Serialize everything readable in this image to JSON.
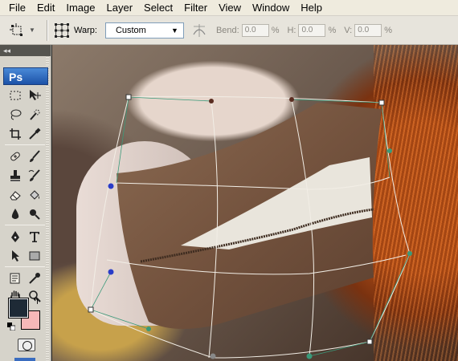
{
  "menu": [
    "File",
    "Edit",
    "Image",
    "Layer",
    "Select",
    "Filter",
    "View",
    "Window",
    "Help"
  ],
  "options": {
    "tool_preset_icon": "transform-tool-icon",
    "warp_icon": "warp-grid-icon",
    "warp_label": "Warp:",
    "warp_value": "Custom",
    "orientation_icon": "change-warp-orientation-icon",
    "bend_label": "Bend:",
    "bend_value": "0.0",
    "h_label": "H:",
    "h_value": "0.0",
    "v_label": "V:",
    "v_value": "0.0",
    "percent": "%"
  },
  "toolbox": {
    "collapse": "◂◂",
    "logo": "Ps",
    "foreground_color": "#1e2a36",
    "background_color": "#f6b8b8"
  },
  "canvas": {
    "warp_grid_color": "#f2eee6",
    "handle_color": "#3a9a7a"
  }
}
